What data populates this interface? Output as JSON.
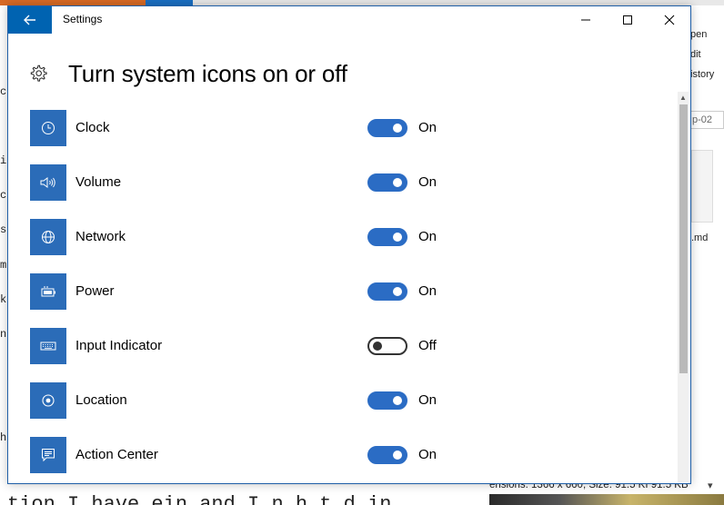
{
  "window": {
    "app_title": "Settings",
    "page_title": "Turn system icons on or off"
  },
  "icons": {
    "back": "back-arrow-icon",
    "settings": "gear-icon",
    "minimize": "minimize-icon",
    "maximize": "maximize-icon",
    "close": "close-icon"
  },
  "items": [
    {
      "label": "Clock",
      "state": "On",
      "enabled": true,
      "icon": "clock-icon"
    },
    {
      "label": "Volume",
      "state": "On",
      "enabled": true,
      "icon": "volume-icon"
    },
    {
      "label": "Network",
      "state": "On",
      "enabled": true,
      "icon": "globe-icon"
    },
    {
      "label": "Power",
      "state": "On",
      "enabled": true,
      "icon": "battery-icon"
    },
    {
      "label": "Input Indicator",
      "state": "Off",
      "enabled": false,
      "icon": "keyboard-icon"
    },
    {
      "label": "Location",
      "state": "On",
      "enabled": true,
      "icon": "location-icon"
    },
    {
      "label": "Action Center",
      "state": "On",
      "enabled": true,
      "icon": "action-center-icon"
    }
  ],
  "background": {
    "right_pane": [
      "pen",
      "dit",
      "istory"
    ],
    "path_fragment": "p-02",
    "file_ext": ".md",
    "status_bar": "ensions: 1366 x 660, Size: 91.5 KI 91.5 KB",
    "left_letters": [
      "c",
      "i",
      "c",
      "s",
      "m",
      "k",
      "n",
      "h"
    ],
    "bottom_text": "tion   I have  ein   and  I  n  h  t   d  in"
  },
  "colors": {
    "accent": "#0063b1",
    "toggle_on": "#2b6cc4",
    "icon_tile": "#2b6cb8"
  }
}
